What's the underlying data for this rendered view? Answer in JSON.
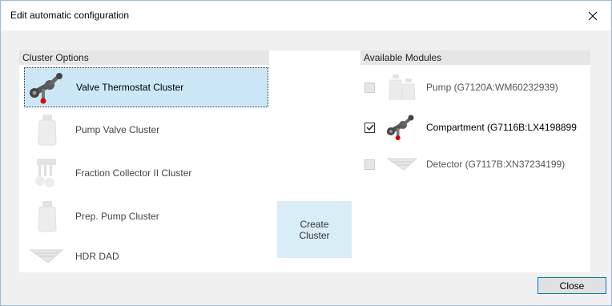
{
  "window": {
    "title": "Edit automatic configuration"
  },
  "cluster_options": {
    "header": "Cluster Options",
    "items": [
      {
        "label": "Valve Thermostat Cluster",
        "icon": "valve-thermostat-icon",
        "selected": true
      },
      {
        "label": "Pump Valve Cluster",
        "icon": "pump-bottle-icon"
      },
      {
        "label": "Fraction Collector II Cluster",
        "icon": "fraction-collector-icon"
      },
      {
        "label": "Prep. Pump Cluster",
        "icon": "pump-bottle-icon"
      },
      {
        "label": "HDR DAD",
        "icon": "detector-icon"
      }
    ]
  },
  "create_cluster": {
    "line1": "Create",
    "line2": "Cluster"
  },
  "available_modules": {
    "header": "Available Modules",
    "items": [
      {
        "label": "Pump (G7120A:WM60232939)",
        "checked": false,
        "icon": "double-bottle-icon"
      },
      {
        "label": "Compartment (G7116B:LX4198899",
        "checked": true,
        "icon": "valve-thermostat-icon"
      },
      {
        "label": "Detector (G7117B:XN37234199)",
        "checked": false,
        "icon": "detector-icon"
      }
    ]
  },
  "buttons": {
    "close": "Close"
  },
  "colors": {
    "selection": "#cce8f7",
    "accent": "#0078d7",
    "create_button": "#d9edf7"
  }
}
